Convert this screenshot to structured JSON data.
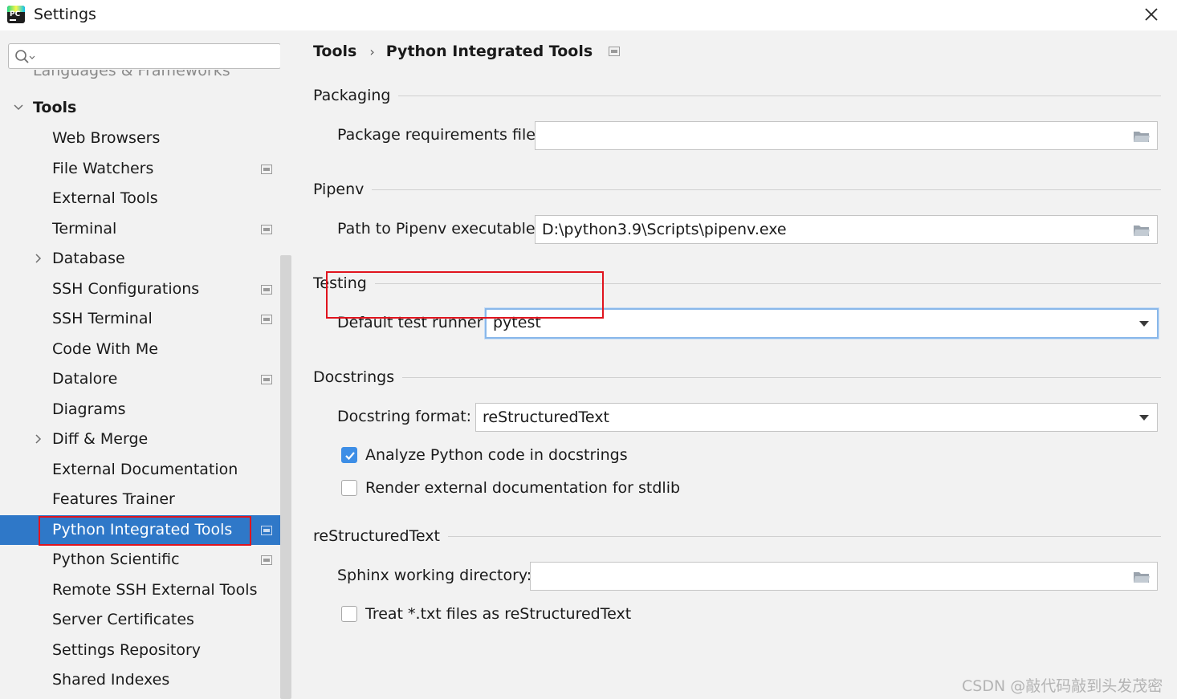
{
  "window": {
    "title": "Settings"
  },
  "sidebar": {
    "search": {
      "value": "",
      "placeholder": ""
    },
    "cutoff_item": "Languages & Frameworks",
    "root": {
      "label": "Tools",
      "expanded": true
    },
    "items": [
      {
        "label": "Web Browsers",
        "expandable": false,
        "project_level": false,
        "selected": false
      },
      {
        "label": "File Watchers",
        "expandable": false,
        "project_level": true,
        "selected": false
      },
      {
        "label": "External Tools",
        "expandable": false,
        "project_level": false,
        "selected": false
      },
      {
        "label": "Terminal",
        "expandable": false,
        "project_level": true,
        "selected": false
      },
      {
        "label": "Database",
        "expandable": true,
        "project_level": false,
        "selected": false
      },
      {
        "label": "SSH Configurations",
        "expandable": false,
        "project_level": true,
        "selected": false
      },
      {
        "label": "SSH Terminal",
        "expandable": false,
        "project_level": true,
        "selected": false
      },
      {
        "label": "Code With Me",
        "expandable": false,
        "project_level": false,
        "selected": false
      },
      {
        "label": "Datalore",
        "expandable": false,
        "project_level": true,
        "selected": false
      },
      {
        "label": "Diagrams",
        "expandable": false,
        "project_level": false,
        "selected": false
      },
      {
        "label": "Diff & Merge",
        "expandable": true,
        "project_level": false,
        "selected": false
      },
      {
        "label": "External Documentation",
        "expandable": false,
        "project_level": false,
        "selected": false
      },
      {
        "label": "Features Trainer",
        "expandable": false,
        "project_level": false,
        "selected": false
      },
      {
        "label": "Python Integrated Tools",
        "expandable": false,
        "project_level": true,
        "selected": true
      },
      {
        "label": "Python Scientific",
        "expandable": false,
        "project_level": true,
        "selected": false
      },
      {
        "label": "Remote SSH External Tools",
        "expandable": false,
        "project_level": false,
        "selected": false
      },
      {
        "label": "Server Certificates",
        "expandable": false,
        "project_level": false,
        "selected": false
      },
      {
        "label": "Settings Repository",
        "expandable": false,
        "project_level": false,
        "selected": false
      },
      {
        "label": "Shared Indexes",
        "expandable": false,
        "project_level": false,
        "selected": false
      }
    ]
  },
  "breadcrumb": {
    "parent": "Tools",
    "separator": "›",
    "current": "Python Integrated Tools"
  },
  "sections": {
    "packaging": {
      "title": "Packaging",
      "requirements_label": "Package requirements file:",
      "requirements_value": ""
    },
    "pipenv": {
      "title": "Pipenv",
      "path_label": "Path to Pipenv executable:",
      "path_value": "D:\\python3.9\\Scripts\\pipenv.exe"
    },
    "testing": {
      "title": "Testing",
      "runner_label": "Default test runner:",
      "runner_value": "pytest"
    },
    "docstrings": {
      "title": "Docstrings",
      "format_label": "Docstring format:",
      "format_value": "reStructuredText",
      "analyze_label": "Analyze Python code in docstrings",
      "analyze_checked": true,
      "render_label": "Render external documentation for stdlib",
      "render_checked": false
    },
    "restructuredtext": {
      "title": "reStructuredText",
      "sphinx_label": "Sphinx working directory:",
      "sphinx_value": "",
      "treat_txt_label": "Treat *.txt files as reStructuredText",
      "treat_txt_checked": false
    }
  },
  "watermark": "CSDN @敲代码敲到头发茂密",
  "colors": {
    "selection": "#2f78c8",
    "highlight_box": "#e0141e",
    "checkbox_checked": "#3d8ee6",
    "focus_border": "#8ab8ea"
  }
}
